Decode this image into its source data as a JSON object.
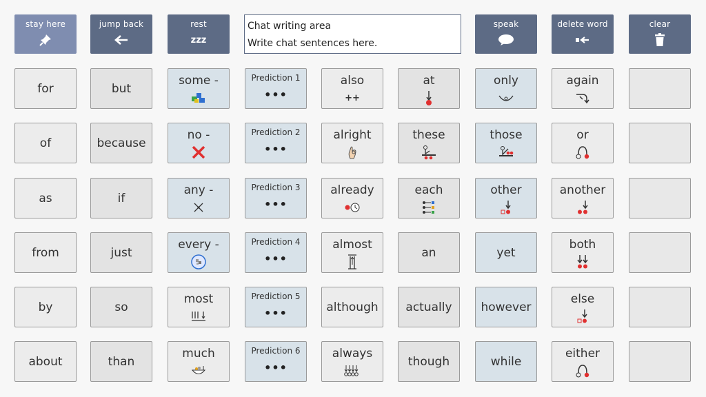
{
  "toolbar": {
    "stay_here": "stay here",
    "jump_back": "jump back",
    "rest": "rest",
    "rest_icon": "zzz",
    "speak": "speak",
    "delete_word": "delete word",
    "clear": "clear"
  },
  "chat": {
    "title": "Chat writing area",
    "placeholder": "Write chat sentences here."
  },
  "grid": {
    "r1": {
      "c1": "for",
      "c2": "but",
      "c3": "some -",
      "c4": "Prediction 1",
      "c5": "also",
      "c5_sym": "++",
      "c6": "at",
      "c7": "only",
      "c8": "again"
    },
    "r2": {
      "c1": "of",
      "c2": "because",
      "c3": "no -",
      "c4": "Prediction 2",
      "c5": "alright",
      "c6": "these",
      "c7": "those",
      "c8": "or"
    },
    "r3": {
      "c1": "as",
      "c2": "if",
      "c3": "any -",
      "c4": "Prediction 3",
      "c5": "already",
      "c6": "each",
      "c7": "other",
      "c8": "another"
    },
    "r4": {
      "c1": "from",
      "c2": "just",
      "c3": "every -",
      "c4": "Prediction 4",
      "c5": "almost",
      "c6": "an",
      "c7": "yet",
      "c8": "both"
    },
    "r5": {
      "c1": "by",
      "c2": "so",
      "c3": "most",
      "c4": "Prediction 5",
      "c5": "although",
      "c6": "actually",
      "c7": "however",
      "c8": "else"
    },
    "r6": {
      "c1": "about",
      "c2": "than",
      "c3": "much",
      "c4": "Prediction 6",
      "c5": "always",
      "c6": "though",
      "c7": "while",
      "c8": "either"
    },
    "dots": "•••"
  },
  "colors": {
    "toolbar": "#5d6b85",
    "toolbar_active": "#7f8db0",
    "cell_light": "#ececec",
    "cell_gray": "#e3e3e3",
    "cell_blue": "#d8e2e9",
    "symbol_red": "#e03030"
  }
}
